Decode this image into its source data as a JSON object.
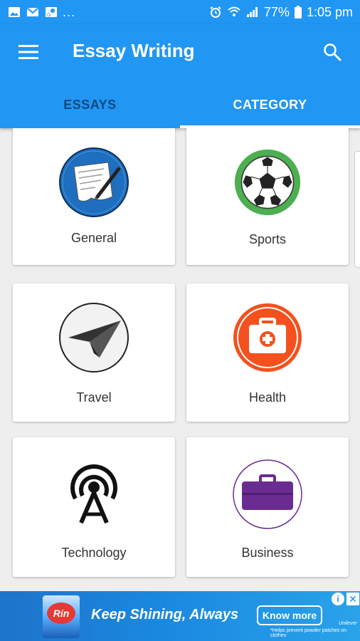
{
  "status_bar": {
    "icons_left": [
      "gallery-icon",
      "gmail-icon",
      "maps-icon"
    ],
    "more": "...",
    "battery": "77%",
    "time": "1:05 pm"
  },
  "app_bar": {
    "title": "Essay Writing",
    "tabs": [
      {
        "label": "ESSAYS",
        "active": false
      },
      {
        "label": "CATEGORY",
        "active": true
      }
    ]
  },
  "categories": [
    {
      "label": "General",
      "icon": "document-pen-icon"
    },
    {
      "label": "Sports",
      "icon": "soccer-ball-icon"
    },
    {
      "label": "Travel",
      "icon": "paper-plane-icon"
    },
    {
      "label": "Health",
      "icon": "first-aid-kit-icon"
    },
    {
      "label": "Technology",
      "icon": "antenna-tower-icon"
    },
    {
      "label": "Business",
      "icon": "briefcase-icon"
    }
  ],
  "ad": {
    "product_logo": "Rin",
    "headline": "Keep Shining, Always",
    "cta": "Know more",
    "note": "*Helps prevent powder patches on clothes",
    "brand": "Unilever"
  },
  "colors": {
    "primary": "#2196f3",
    "tab_inactive": "#0d4a80",
    "health": "#f4511e",
    "sports": "#4caf50",
    "business": "#6a2c91",
    "general": "#1e6fbf"
  }
}
